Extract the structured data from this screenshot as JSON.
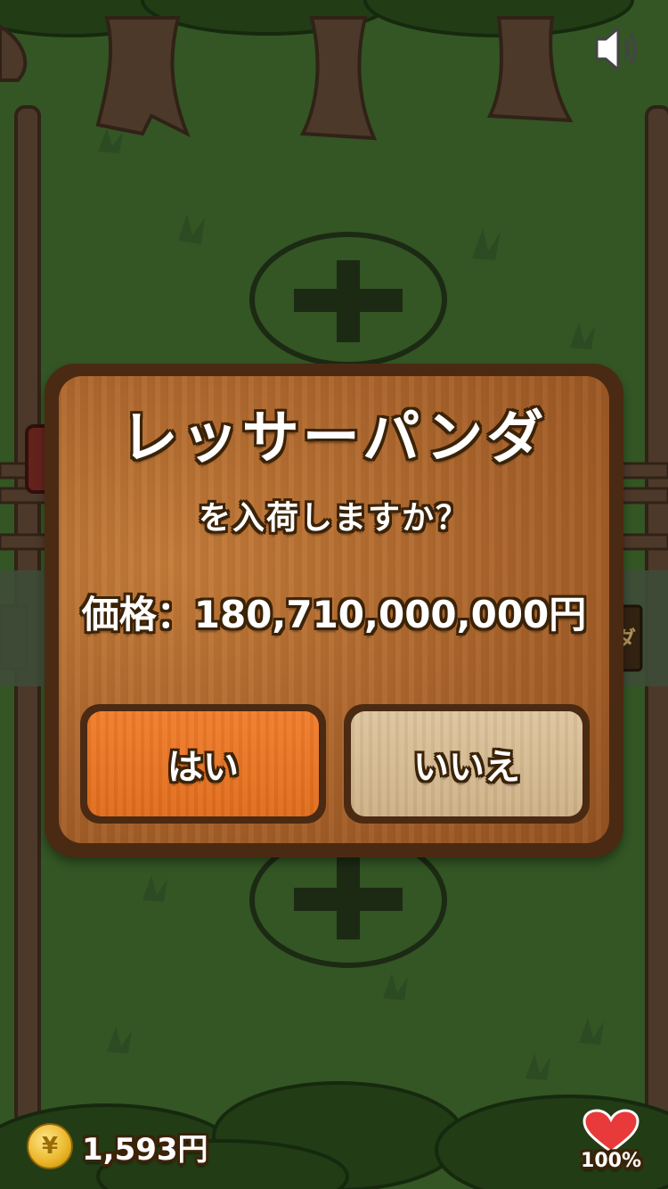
{
  "dialog": {
    "animal_name": "レッサーパンダ",
    "question": "を入荷しますか？",
    "price_label": "価格：",
    "price_value": "180,710,000,000円",
    "yes_label": "はい",
    "no_label": "いいえ"
  },
  "hud": {
    "money": "1,593円",
    "coin_symbol": "¥",
    "health": "100%"
  },
  "background_sign_text": "ダ",
  "icons": [
    "speaker-icon",
    "plus-icon",
    "coin-icon",
    "heart-icon"
  ],
  "colors": {
    "grass": "#3f6a2c",
    "wood_dark": "#4a2a12",
    "wood": "#b06a2e",
    "yes_button": "#ec7626",
    "no_button": "#d7bd94",
    "heart": "#e83a3a"
  }
}
